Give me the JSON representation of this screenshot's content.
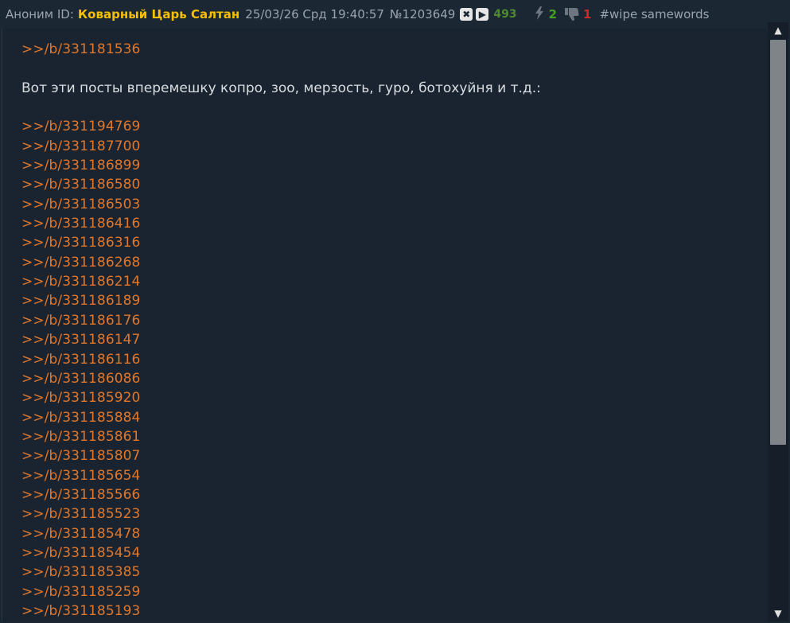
{
  "header": {
    "anon_label": "Аноним ID:",
    "poster_name": "Коварный Царь Салтан",
    "datetime": "25/03/26 Срд 19:40:57",
    "post_number": "№1203649",
    "count": "493",
    "likes": "2",
    "dislikes": "1",
    "tags": "#wipe samewords"
  },
  "post": {
    "first_link": ">>/b/331181536",
    "text": "Вот эти посты вперемешку копро, зоо, мерзость, гуро, ботохуйня и т.д.:",
    "links": [
      ">>/b/331194769",
      ">>/b/331187700",
      ">>/b/331186899",
      ">>/b/331186580",
      ">>/b/331186503",
      ">>/b/331186416",
      ">>/b/331186316",
      ">>/b/331186268",
      ">>/b/331186214",
      ">>/b/331186189",
      ">>/b/331186176",
      ">>/b/331186147",
      ">>/b/331186116",
      ">>/b/331186086",
      ">>/b/331185920",
      ">>/b/331185884",
      ">>/b/331185861",
      ">>/b/331185807",
      ">>/b/331185654",
      ">>/b/331185566",
      ">>/b/331185523",
      ">>/b/331185478",
      ">>/b/331185454",
      ">>/b/331185385",
      ">>/b/331185259",
      ">>/b/331185193"
    ]
  },
  "icons": {
    "close": "close-icon",
    "play": "play-icon",
    "bolt": "bolt-icon",
    "dislike": "thumbs-down-icon"
  },
  "colors": {
    "link": "#e0772a",
    "name": "#f6c000",
    "like": "#43a024",
    "dislike": "#d8262a"
  }
}
